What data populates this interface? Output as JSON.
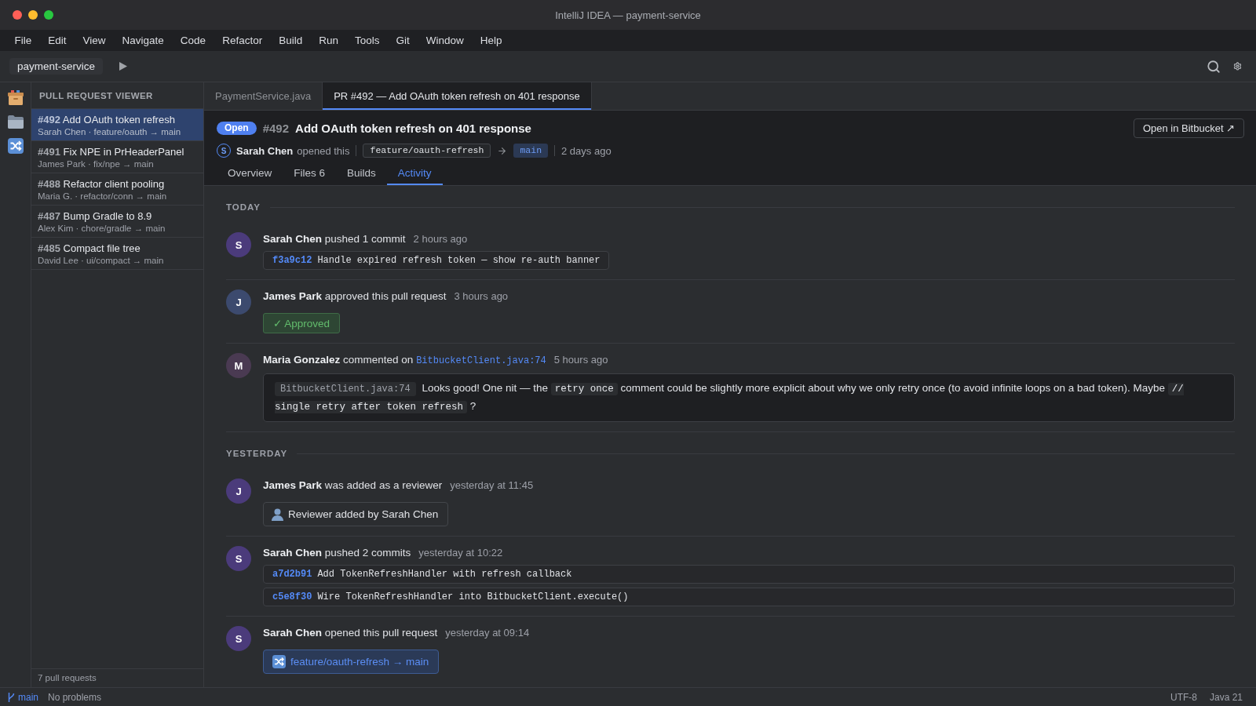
{
  "window": {
    "title": "IntelliJ IDEA — payment-service"
  },
  "menu_bar": [
    "File",
    "Edit",
    "View",
    "Navigate",
    "Code",
    "Refactor",
    "Build",
    "Run",
    "Tools",
    "Git",
    "Window",
    "Help"
  ],
  "toolbar": {
    "project": "payment-service"
  },
  "sidebar": {
    "title": "PULL REQUEST VIEWER",
    "items": [
      {
        "number": "#492",
        "title": "Add OAuth token refresh",
        "meta": "Sarah Chen · feature/oauth → main",
        "selected": true
      },
      {
        "number": "#491",
        "title": "Fix NPE in PrHeaderPanel",
        "meta": "James Park · fix/npe → main",
        "selected": false
      },
      {
        "number": "#488",
        "title": "Refactor client pooling",
        "meta": "Maria G. · refactor/conn → main",
        "selected": false
      },
      {
        "number": "#487",
        "title": "Bump Gradle to 8.9",
        "meta": "Alex Kim · chore/gradle → main",
        "selected": false
      },
      {
        "number": "#485",
        "title": "Compact file tree",
        "meta": "David Lee · ui/compact → main",
        "selected": false
      }
    ],
    "footer": "7 pull requests"
  },
  "editor_tabs": [
    {
      "label": "PaymentService.java",
      "selected": false
    },
    {
      "label": "PR #492 — Add OAuth token refresh on 401 response",
      "selected": true
    }
  ],
  "pr_header": {
    "status": "Open",
    "number": "#492",
    "title": "Add OAuth token refresh on 401 response",
    "author_initial": "S",
    "author": "Sarah Chen",
    "action": "opened this",
    "source_branch": "feature/oauth-refresh",
    "target_branch": "main",
    "age": "2 days ago",
    "open_button": "Open in Bitbucket ↗"
  },
  "pr_tabs": [
    {
      "label": "Overview",
      "selected": false
    },
    {
      "label": "Files 6",
      "selected": false
    },
    {
      "label": "Builds",
      "selected": false
    },
    {
      "label": "Activity",
      "selected": true
    }
  ],
  "activity": {
    "groups": [
      {
        "label": "TODAY",
        "events": [
          {
            "kind": "commits",
            "initial": "S",
            "color": "#4b3b7b",
            "author": "Sarah Chen",
            "action": "pushed 1 commit",
            "time": "2 hours ago",
            "commits": [
              {
                "hash": "f3a9c12",
                "message": "Handle expired refresh token — show re-auth banner"
              }
            ]
          },
          {
            "kind": "approval",
            "initial": "J",
            "color": "#3c4a6e",
            "author": "James Park",
            "action": "approved this pull request",
            "time": "3 hours ago",
            "badge": "✓ Approved"
          },
          {
            "kind": "comment",
            "initial": "M",
            "color": "#4a3a52",
            "author": "Maria Gonzalez",
            "action": "commented on",
            "link": "BitbucketClient.java:74",
            "time": "5 hours ago",
            "body": [
              {
                "kind": "file",
                "text": "BitbucketClient.java:74"
              },
              {
                "kind": "text",
                "text": "Looks good! One nit — the"
              },
              {
                "kind": "code",
                "text": "retry once"
              },
              {
                "kind": "text",
                "text": "comment could be slightly more explicit about why we only retry once (to avoid infinite loops on a bad token). Maybe"
              },
              {
                "kind": "code",
                "text": "// single retry after token refresh"
              },
              {
                "kind": "text",
                "text": "?"
              }
            ]
          }
        ]
      },
      {
        "label": "YESTERDAY",
        "events": [
          {
            "kind": "reviewer",
            "initial": "J",
            "color": "#4b3b7b",
            "author": "James Park",
            "action": "was added as a reviewer",
            "time": "yesterday at 11:45",
            "note": "Reviewer added by Sarah Chen"
          },
          {
            "kind": "commits",
            "initial": "S",
            "color": "#4b3b7b",
            "author": "Sarah Chen",
            "action": "pushed 2 commits",
            "time": "yesterday at 10:22",
            "commits": [
              {
                "hash": "a7d2b91",
                "message": "Add TokenRefreshHandler with refresh callback"
              },
              {
                "hash": "c5e8f30",
                "message": "Wire TokenRefreshHandler into BitbucketClient.execute()"
              }
            ]
          },
          {
            "kind": "opened",
            "initial": "S",
            "color": "#4b3b7b",
            "author": "Sarah Chen",
            "action": "opened this pull request",
            "time": "yesterday at 09:14",
            "branch": "feature/oauth-refresh → main"
          }
        ]
      }
    ]
  },
  "status_bar": {
    "branch": "main",
    "problems": "No problems",
    "encoding": "UTF-8",
    "java": "Java 21"
  }
}
